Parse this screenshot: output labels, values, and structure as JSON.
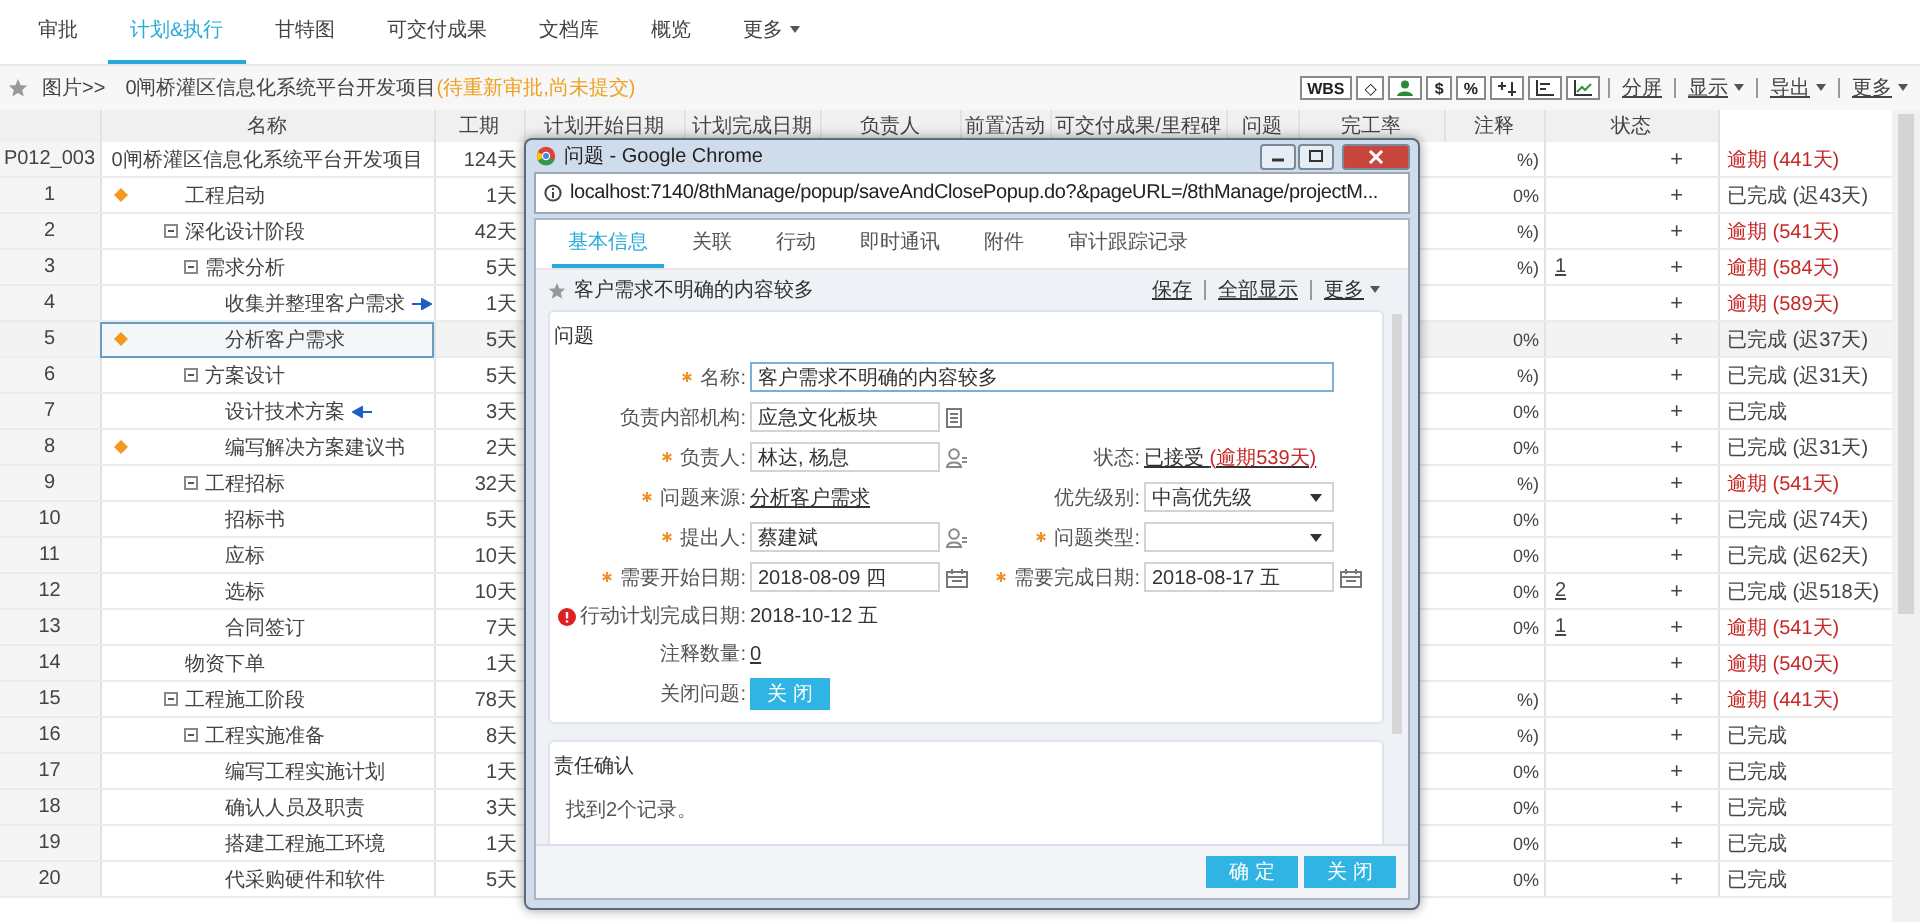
{
  "nav_tabs": [
    {
      "label": "审批",
      "selected": false,
      "has_menu": false
    },
    {
      "label": "计划&执行",
      "selected": true,
      "has_menu": false
    },
    {
      "label": "甘特图",
      "selected": false,
      "has_menu": false
    },
    {
      "label": "可交付成果",
      "selected": false,
      "has_menu": false
    },
    {
      "label": "文档库",
      "selected": false,
      "has_menu": false
    },
    {
      "label": "概览",
      "selected": false,
      "has_menu": false
    },
    {
      "label": "更多",
      "selected": false,
      "has_menu": true
    }
  ],
  "breadcrumb": {
    "prefix": "图片>>",
    "project": "0闸桥灌区信息化系统平台开发项目",
    "status": "(待重新审批,尚未提交)"
  },
  "toolbar": {
    "tools": [
      {
        "kind": "text",
        "label": "WBS"
      },
      {
        "kind": "text",
        "label": "◇"
      },
      {
        "kind": "icon"
      },
      {
        "kind": "text",
        "label": "$"
      },
      {
        "kind": "text",
        "label": "%"
      },
      {
        "kind": "icon"
      },
      {
        "kind": "icon"
      },
      {
        "kind": "icon"
      }
    ],
    "menus": [
      {
        "label": "分屏",
        "has_menu": false
      },
      {
        "label": "显示",
        "has_menu": true
      },
      {
        "label": "导出",
        "has_menu": true
      },
      {
        "label": "更多",
        "has_menu": true
      }
    ]
  },
  "table": {
    "columns": [
      "名称",
      "工期",
      "计划开始日期",
      "计划完成日期",
      "负责人",
      "前置活动",
      "可交付成果/里程碑",
      "问题",
      "完工率",
      "注释",
      "状态"
    ],
    "rows": [
      {
        "id": "P012_003",
        "name": "0闸桥灌区信息化系统平台开发项目",
        "duration": "124天",
        "completion": "%)",
        "note_action": "+",
        "status": "逾期 (441天)",
        "overdue": true,
        "selected": false,
        "children": [
          {
            "id": "1",
            "kind": "milestone",
            "name": "工程启动",
            "duration": "1天",
            "completion": "0%",
            "note_action": "+",
            "status": "已完成 (迟43天)",
            "overdue": false,
            "selected": false
          },
          {
            "id": "2",
            "name": "深化设计阶段",
            "expanded": true,
            "duration": "42天",
            "completion": "%)",
            "note_action": "+",
            "status": "逾期 (541天)",
            "overdue": true,
            "selected": false,
            "children": [
              {
                "id": "3",
                "name": "需求分析",
                "expanded": true,
                "duration": "5天",
                "completion": "%)",
                "note_count": "1",
                "note_action": "+",
                "status": "逾期 (584天)",
                "overdue": true,
                "selected": false,
                "children": [
                  {
                    "id": "4",
                    "kind": "outgoing",
                    "name": "收集并整理客户需求",
                    "duration": "1天",
                    "note_action": "+",
                    "status": "逾期 (589天)",
                    "overdue": true,
                    "selected": false
                  },
                  {
                    "id": "5",
                    "kind": "milestone",
                    "name": "分析客户需求",
                    "duration": "5天",
                    "completion": "0%",
                    "note_action": "+",
                    "status": "已完成 (迟37天)",
                    "overdue": false,
                    "selected": true
                  }
                ]
              },
              {
                "id": "6",
                "name": "方案设计",
                "expanded": true,
                "duration": "5天",
                "completion": "%)",
                "note_action": "+",
                "status": "已完成 (迟31天)",
                "overdue": false,
                "selected": false,
                "children": [
                  {
                    "id": "7",
                    "kind": "incoming",
                    "name": "设计技术方案",
                    "duration": "3天",
                    "completion": "0%",
                    "note_action": "+",
                    "status": "已完成",
                    "overdue": false,
                    "selected": false
                  },
                  {
                    "id": "8",
                    "kind": "milestone",
                    "name": "编写解决方案建议书",
                    "duration": "2天",
                    "completion": "0%",
                    "note_action": "+",
                    "status": "已完成 (迟31天)",
                    "overdue": false,
                    "selected": false
                  }
                ]
              },
              {
                "id": "9",
                "name": "工程招标",
                "expanded": true,
                "duration": "32天",
                "completion": "%)",
                "note_action": "+",
                "status": "逾期 (541天)",
                "overdue": true,
                "selected": false,
                "children": [
                  {
                    "id": "10",
                    "name": "招标书",
                    "duration": "5天",
                    "completion": "0%",
                    "note_action": "+",
                    "status": "已完成 (迟74天)",
                    "overdue": false,
                    "selected": false
                  },
                  {
                    "id": "11",
                    "name": "应标",
                    "duration": "10天",
                    "completion": "0%",
                    "note_action": "+",
                    "status": "已完成 (迟62天)",
                    "overdue": false,
                    "selected": false
                  },
                  {
                    "id": "12",
                    "name": "选标",
                    "duration": "10天",
                    "completion": "0%",
                    "note_count": "2",
                    "note_action": "+",
                    "status": "已完成 (迟518天)",
                    "overdue": false,
                    "selected": false
                  },
                  {
                    "id": "13",
                    "name": "合同签订",
                    "duration": "7天",
                    "completion": "0%",
                    "note_count": "1",
                    "note_action": "+",
                    "status": "逾期 (541天)",
                    "overdue": true,
                    "selected": false
                  }
                ]
              }
            ]
          },
          {
            "id": "14",
            "name": "物资下单",
            "duration": "1天",
            "note_action": "+",
            "status": "逾期 (540天)",
            "overdue": true,
            "selected": false
          },
          {
            "id": "15",
            "name": "工程施工阶段",
            "expanded": true,
            "duration": "78天",
            "completion": "%)",
            "note_action": "+",
            "status": "逾期 (441天)",
            "overdue": true,
            "selected": false,
            "children": [
              {
                "id": "16",
                "name": "工程实施准备",
                "expanded": true,
                "duration": "8天",
                "completion": "%)",
                "note_action": "+",
                "status": "已完成",
                "overdue": false,
                "selected": false,
                "children": [
                  {
                    "id": "17",
                    "name": "编写工程实施计划",
                    "duration": "1天",
                    "completion": "0%",
                    "note_action": "+",
                    "status": "已完成",
                    "overdue": false,
                    "selected": false
                  },
                  {
                    "id": "18",
                    "name": "确认人员及职责",
                    "duration": "3天",
                    "completion": "0%",
                    "note_action": "+",
                    "status": "已完成",
                    "overdue": false,
                    "selected": false
                  },
                  {
                    "id": "19",
                    "name": "搭建工程施工环境",
                    "duration": "1天",
                    "completion": "0%",
                    "note_action": "+",
                    "status": "已完成",
                    "overdue": false,
                    "selected": false
                  },
                  {
                    "id": "20",
                    "name": "代采购硬件和软件",
                    "duration": "5天",
                    "completion": "0%",
                    "note_action": "+",
                    "status": "已完成",
                    "overdue": false,
                    "selected": false
                  }
                ]
              }
            ]
          }
        ]
      }
    ]
  },
  "popup": {
    "title": "问题 - Google Chrome",
    "url": "localhost:7140/8thManage/popup/saveAndClosePopup.do?&pageURL=/8thManage/projectM...",
    "tabs": [
      {
        "label": "基本信息",
        "selected": true
      },
      {
        "label": "关联",
        "selected": false
      },
      {
        "label": "行动",
        "selected": false
      },
      {
        "label": "即时通讯",
        "selected": false
      },
      {
        "label": "附件",
        "selected": false
      },
      {
        "label": "审计跟踪记录",
        "selected": false
      }
    ],
    "record_title": "客户需求不明确的内容较多",
    "actions": [
      {
        "label": "保存",
        "has_menu": false
      },
      {
        "label": "全部显示",
        "has_menu": false
      },
      {
        "label": "更多",
        "has_menu": true
      }
    ],
    "section": {
      "title": "问题",
      "rows": [
        {
          "items": [
            {
              "kind": "input",
              "label": "名称:",
              "required": true,
              "wide": true,
              "value": "客户需求不明确的内容较多"
            }
          ]
        },
        {
          "items": [
            {
              "kind": "input-list",
              "label": "负责内部机构:",
              "value": "应急文化板块"
            }
          ]
        },
        {
          "items": [
            {
              "kind": "input-person",
              "label": "负责人:",
              "required": true,
              "value": "林达, 杨息"
            },
            {
              "kind": "status",
              "label": "状态:",
              "value": "已接受",
              "overdue": "(逾期539天)"
            }
          ]
        },
        {
          "items": [
            {
              "kind": "link",
              "label": "问题来源:",
              "required": true,
              "value": "分析客户需求"
            },
            {
              "kind": "select",
              "label": "优先级别:",
              "value": "中高优先级"
            }
          ]
        },
        {
          "items": [
            {
              "kind": "input-person",
              "label": "提出人:",
              "required": true,
              "value": "蔡建斌"
            },
            {
              "kind": "select",
              "label": "问题类型:",
              "required": true
            }
          ]
        },
        {
          "items": [
            {
              "kind": "input-date",
              "label": "需要开始日期:",
              "required": true,
              "value": "2018-08-09 四"
            },
            {
              "kind": "input-date",
              "label": "需要完成日期:",
              "required": true,
              "value": "2018-08-17 五"
            }
          ]
        },
        {
          "items": [
            {
              "kind": "text",
              "label": "行动计划完成日期:",
              "error": true,
              "value": "2018-10-12 五"
            }
          ]
        },
        {
          "items": [
            {
              "kind": "link",
              "label": "注释数量:",
              "value": "0"
            }
          ]
        },
        {
          "items": [
            {
              "kind": "button",
              "label": "关闭问题:",
              "value": "关 闭"
            }
          ]
        }
      ]
    },
    "section2": {
      "title": "责任确认",
      "text": "找到2个记录。"
    },
    "buttons": [
      "确 定",
      "关 闭"
    ]
  }
}
